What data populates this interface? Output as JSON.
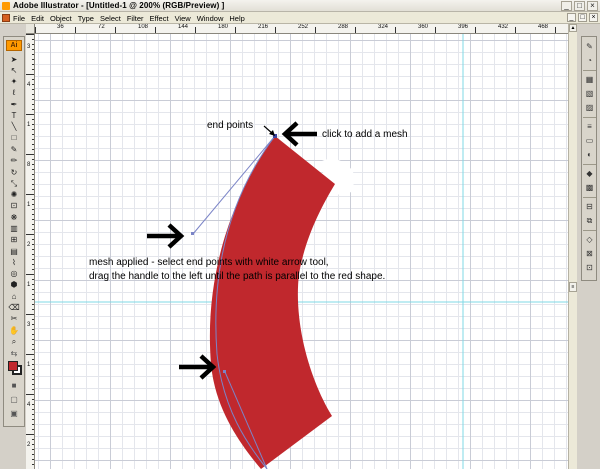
{
  "window": {
    "title": "Adobe Illustrator - [Untitled-1 @ 200% (RGB/Preview) ]",
    "buttons": [
      "_",
      "□",
      "×"
    ]
  },
  "menu": {
    "items": [
      "File",
      "Edit",
      "Object",
      "Type",
      "Select",
      "Filter",
      "Effect",
      "View",
      "Window",
      "Help"
    ],
    "doc_buttons": [
      "_",
      "□",
      "×"
    ]
  },
  "toolbox": {
    "logo": "Ai"
  },
  "rulers": {
    "top": [
      "36",
      "72",
      "108",
      "144",
      "180",
      "216",
      "252",
      "288",
      "324",
      "360",
      "396",
      "432",
      "468"
    ],
    "left": [
      "3",
      "4",
      "1",
      "8",
      "1",
      "2",
      "1",
      "3",
      "1",
      "4",
      "2"
    ]
  },
  "annotations": {
    "end_points": "end points",
    "click_mesh": "click to add a mesh",
    "instruction_line1": "mesh applied - select end points with white arrow tool,",
    "instruction_line2": "drag the handle to the left until the path is parallel to the red shape."
  },
  "colors": {
    "shape_fill": "#c0282d",
    "path_stroke": "#7b84c7",
    "guide": "#7fd8e6",
    "accent": "#ff9a00"
  }
}
